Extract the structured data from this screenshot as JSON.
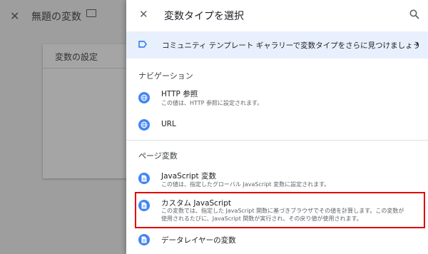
{
  "editor": {
    "title": "無題の変数",
    "card_title": "変数の設定"
  },
  "panel": {
    "title": "変数タイプを選択",
    "banner": "コミュニティ テンプレート ギャラリーで変数タイプをさらに見つけましょう",
    "sections": [
      {
        "title": "ナビゲーション",
        "items": [
          {
            "title": "HTTP 参照",
            "sub": "この値は、HTTP 参照に設定されます。"
          },
          {
            "title": "URL"
          }
        ]
      },
      {
        "title": "ページ変数",
        "items": [
          {
            "title": "JavaScript 変数",
            "sub": "この値は、指定したグローバル JavaScript 変数に設定されます。"
          },
          {
            "title": "カスタム JavaScript",
            "sub1": "この変数では、指定した JavaScript 関数に基づきブラウザでその値を計算します。この変数が",
            "sub2": "使用されるたびに、JavaScript 関数が実行され、その戻り値が使用されます。"
          },
          {
            "title": "データレイヤーの変数"
          }
        ]
      }
    ]
  },
  "colors": {
    "accent": "#4285f4",
    "highlight": "#e00000",
    "banner_bg": "#e8f0fe"
  }
}
